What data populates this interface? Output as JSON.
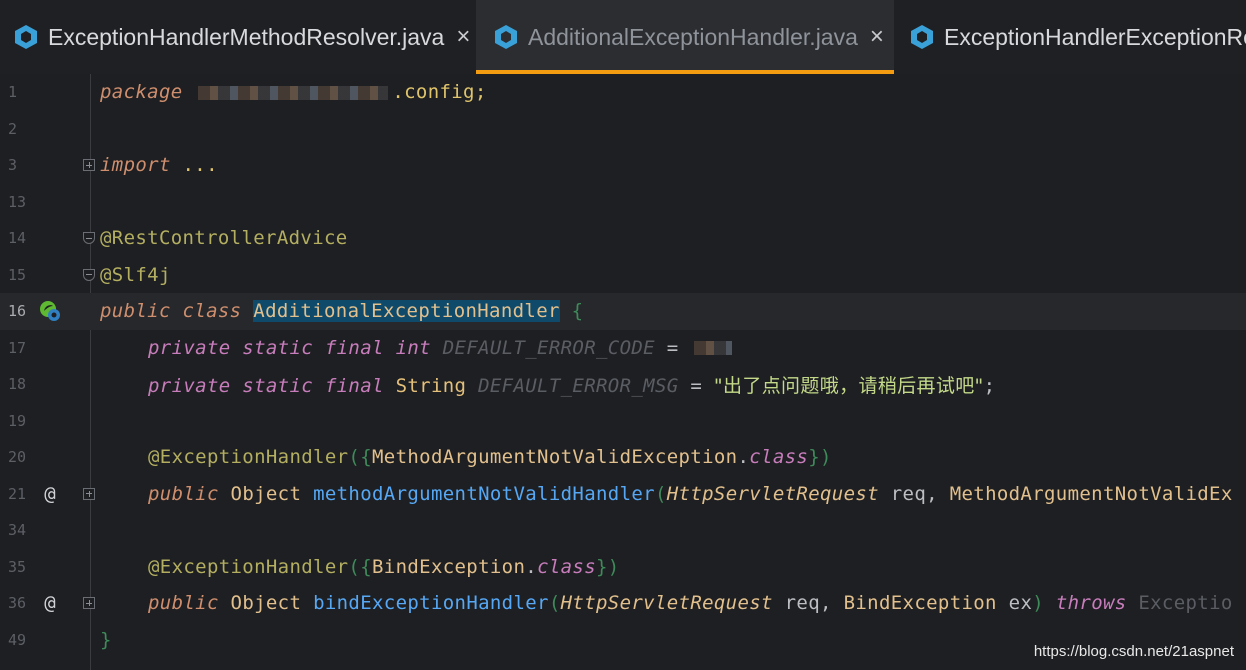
{
  "tabs": [
    {
      "label": "ExceptionHandlerMethodResolver.java",
      "active": false,
      "closable": true
    },
    {
      "label": "AdditionalExceptionHandler.java",
      "active": true,
      "closable": true
    },
    {
      "label": "ExceptionHandlerExceptionResolver.java",
      "active": false,
      "closable": false
    }
  ],
  "close_glyph": "×",
  "accent_color": "#f39c12",
  "code": {
    "l1": {
      "num": "1",
      "kw": "package",
      "suffix": ".config;"
    },
    "l2": {
      "num": "2"
    },
    "l3": {
      "num": "3",
      "kw": "import",
      "rest": " ..."
    },
    "l13": {
      "num": "13"
    },
    "l14": {
      "num": "14",
      "ann": "@RestControllerAdvice"
    },
    "l15": {
      "num": "15",
      "ann": "@Slf4j"
    },
    "l16": {
      "num": "16",
      "kw1": "public",
      "kw2": "class",
      "name": "AdditionalExceptionHandler",
      "brace": "{"
    },
    "l17": {
      "num": "17",
      "mods": "private static final",
      "type": "int",
      "field": "DEFAULT_ERROR_CODE",
      "eq": " = "
    },
    "l18": {
      "num": "18",
      "mods": "private static final",
      "type": "String",
      "field": "DEFAULT_ERROR_MSG",
      "eq": " = ",
      "value": "\"出了点问题哦，请稍后再试吧\"",
      "semi": ";"
    },
    "l19": {
      "num": "19"
    },
    "l20": {
      "num": "20",
      "ann": "@ExceptionHandler",
      "open": "({",
      "cls": "MethodArgumentNotValidException",
      "dot": ".",
      "kwcls": "class",
      "close": "})"
    },
    "l21": {
      "num": "21",
      "kw": "public",
      "ret": "Object",
      "method": "methodArgumentNotValidHandler",
      "po": "(",
      "ptype": "HttpServletRequest",
      "pname": "req",
      "comma": ", ",
      "ptype2": "MethodArgumentNotValidEx"
    },
    "l34": {
      "num": "34"
    },
    "l35": {
      "num": "35",
      "ann": "@ExceptionHandler",
      "open": "({",
      "cls": "BindException",
      "dot": ".",
      "kwcls": "class",
      "close": "})"
    },
    "l36": {
      "num": "36",
      "kw": "public",
      "ret": "Object",
      "method": "bindExceptionHandler",
      "po": "(",
      "ptype": "HttpServletRequest",
      "pname": "req",
      "comma": ", ",
      "ptype2": "BindException",
      "pname2": "ex",
      "pc": ")",
      "throws": "throws",
      "exc": "Exceptio"
    },
    "l49": {
      "num": "49",
      "brace": "}"
    }
  },
  "gutter_marker": "@",
  "watermark": "https://blog.csdn.net/21aspnet"
}
